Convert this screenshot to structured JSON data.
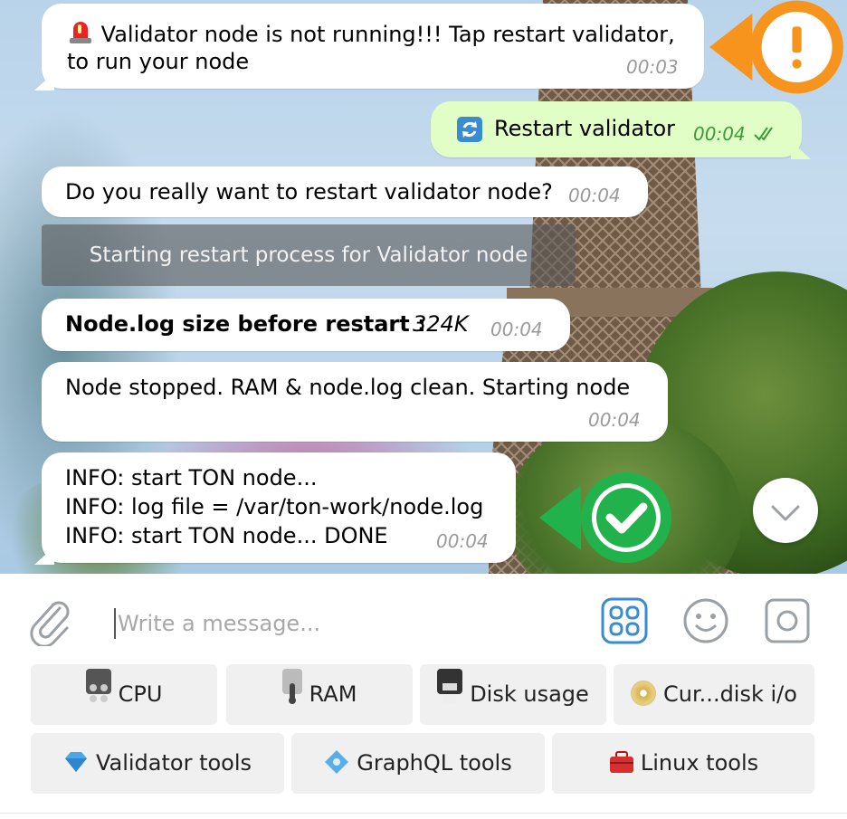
{
  "messages": [
    {
      "text": "Validator node is not running!!! Tap restart validator,",
      "text2": "to run your node",
      "time": "00:03",
      "icon": "rotating-light-icon"
    },
    {
      "text": "Restart validator",
      "time": "00:04",
      "icon": "refresh-icon",
      "status": "read-double-check-icon"
    },
    {
      "text": "Do you really want to restart validator node?",
      "time": "00:04"
    },
    {
      "service": "Starting restart process for Validator node"
    },
    {
      "bold": "Node.log size before restart :",
      "italic": "324K",
      "time": "00:04"
    },
    {
      "text": "Node stopped. RAM & node.log clean. Starting node",
      "time": "00:04"
    },
    {
      "lines": [
        "INFO: start TON node...",
        "INFO: log file = /var/ton-work/node.log",
        "INFO: start TON node... DONE"
      ],
      "time": "00:04"
    }
  ],
  "composer": {
    "placeholder": "Write a message...",
    "icons": [
      "paperclip-icon",
      "bot-commands-icon",
      "emoji-icon",
      "camera-icon"
    ]
  },
  "keyboard": {
    "row1": [
      {
        "label": "CPU",
        "icon": "control-knobs-icon"
      },
      {
        "label": "RAM",
        "icon": "thermometer-icon"
      },
      {
        "label": "Disk usage",
        "icon": "floppy-disk-icon"
      },
      {
        "label": "Cur...disk i/o",
        "icon": "dvd-icon"
      }
    ],
    "row2": [
      {
        "label": "Validator tools",
        "icon": "gem-icon"
      },
      {
        "label": "GraphQL tools",
        "icon": "diamond-shape-icon"
      },
      {
        "label": "Linux tools",
        "icon": "toolbox-icon"
      }
    ]
  },
  "colors": {
    "warning_badge": "#f7941d",
    "success_badge": "#22b24c",
    "outgoing_bubble": "#e1fec6",
    "accent": "#3a8ccf"
  }
}
